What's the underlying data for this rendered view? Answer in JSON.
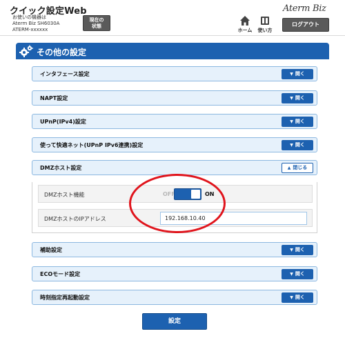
{
  "header": {
    "app_title": "クイック設定Web",
    "device_info": [
      "お使いの機器は",
      "Aterm Biz SH6030A",
      "ATERM-xxxxxx"
    ],
    "status_button": [
      "現在の",
      "状態"
    ],
    "brand": "Aterm Biz",
    "home_label": "ホーム",
    "help_label": "使い方",
    "logout_label": "ログアウト"
  },
  "page": {
    "title": "その他の設定"
  },
  "sections": [
    {
      "label": "インタフェース設定",
      "button": "開く"
    },
    {
      "label": "NAPT設定",
      "button": "開く"
    },
    {
      "label": "UPnP(IPv4)設定",
      "button": "開く"
    },
    {
      "label": "使って快適ネット(UPnP IPv6連携)設定",
      "button": "開く"
    },
    {
      "label": "DMZホスト設定",
      "button": "閉じる"
    },
    {
      "label": "補助設定",
      "button": "開く"
    },
    {
      "label": "ECOモード設定",
      "button": "開く"
    },
    {
      "label": "時刻指定再起動設定",
      "button": "開く"
    }
  ],
  "dmz": {
    "function_label": "DMZホスト機能",
    "off_label": "OFF",
    "on_label": "ON",
    "toggle_state": "ON",
    "ip_label": "DMZホストのIPアドレス",
    "ip_value": "192.168.10.40"
  },
  "submit_label": "設定",
  "colors": {
    "accent": "#1d61b0",
    "section_bg": "#e6f1fb",
    "annotation": "#e0141c"
  }
}
